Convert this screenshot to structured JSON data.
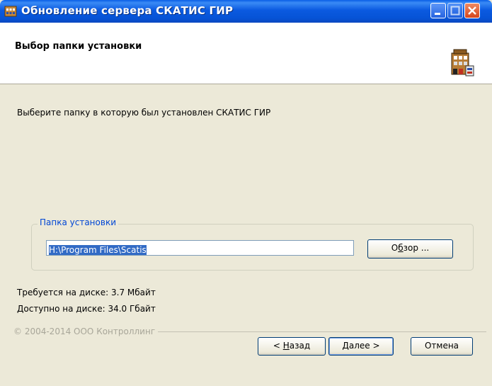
{
  "window": {
    "title": "Обновление сервера СКАТИС ГИР",
    "controls": [
      "minimize-icon",
      "maximize-icon",
      "close-icon"
    ]
  },
  "header": {
    "title": "Выбор папки установки",
    "icon": "installer-building-icon"
  },
  "body": {
    "instruction": "Выберите папку в которую был установлен СКАТИС ГИР"
  },
  "install_folder": {
    "legend": "Папка установки",
    "path_value": "H:\\Program Files\\Scatis",
    "browse_label_pre": "О",
    "browse_label_accel": "б",
    "browse_label_post": "зор ..."
  },
  "disk": {
    "required": "Требуется на диске: 3.7 Мбайт",
    "available": "Доступно на диске: 34.0 Гбайт"
  },
  "footer": {
    "copyright": "© 2004-2014 ООО Контроллинг",
    "back_pre": "< ",
    "back_accel": "Н",
    "back_post": "азад",
    "next_accel": "Д",
    "next_post": "алее >",
    "cancel_label": "Отмена"
  },
  "colors": {
    "titlebar": "#0a5ee6",
    "dialog_bg": "#ece9d8",
    "legend_text": "#0046d5",
    "selection": "#316ac5",
    "close_button": "#d6461c"
  }
}
